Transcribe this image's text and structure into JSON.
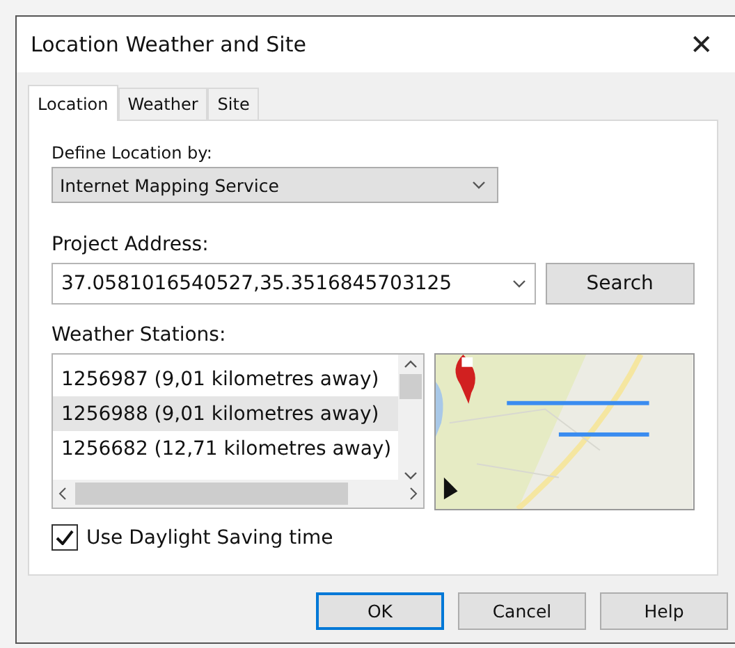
{
  "window": {
    "title": "Location Weather and Site",
    "close": "✕"
  },
  "tabs": [
    {
      "label": "Location",
      "selected": true
    },
    {
      "label": "Weather",
      "selected": false
    },
    {
      "label": "Site",
      "selected": false
    }
  ],
  "define_location": {
    "label": "Define Location by:",
    "value": "Internet Mapping Service"
  },
  "project_address": {
    "label": "Project Address:",
    "value": "37.0581016540527,35.3516845703125",
    "button": "Search"
  },
  "weather_stations": {
    "label": "Weather Stations:",
    "items": [
      {
        "text": "1256987 (9,01 kilometres away)",
        "selected": false
      },
      {
        "text": "1256988 (9,01 kilometres away)",
        "selected": true
      },
      {
        "text": "1256682 (12,71 kilometres away)",
        "selected": false
      }
    ]
  },
  "daylight_saving": {
    "label": "Use Daylight Saving time",
    "checked": true
  },
  "buttons": [
    {
      "label": "OK",
      "default": true
    },
    {
      "label": "Cancel",
      "default": false
    },
    {
      "label": "Help",
      "default": false
    }
  ]
}
